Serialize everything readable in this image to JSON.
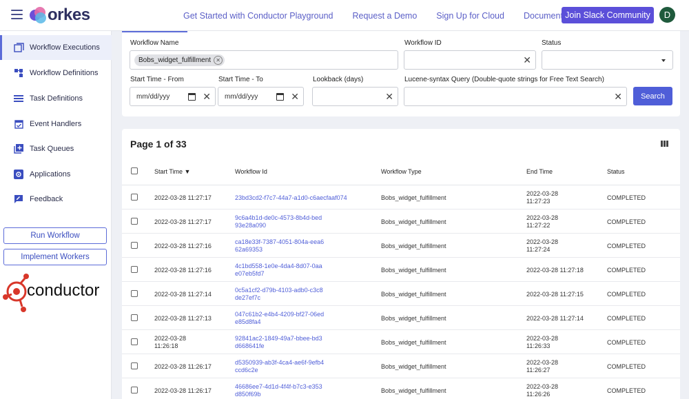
{
  "header": {
    "logo_text": "orkes",
    "nav": [
      "Get Started with Conductor Playground",
      "Request a Demo",
      "Sign Up for Cloud",
      "Documentation"
    ],
    "slack_button": "Join Slack Community",
    "avatar_initial": "D",
    "accent_color": "#5b4fd9"
  },
  "sidebar": {
    "items": [
      {
        "label": "Workflow Executions",
        "icon": "window-icon"
      },
      {
        "label": "Workflow Definitions",
        "icon": "nodes-icon"
      },
      {
        "label": "Task Definitions",
        "icon": "list-icon"
      },
      {
        "label": "Event Handlers",
        "icon": "calendar-check-icon"
      },
      {
        "label": "Task Queues",
        "icon": "queue-add-icon"
      },
      {
        "label": "Applications",
        "icon": "gear-box-icon"
      },
      {
        "label": "Feedback",
        "icon": "feedback-icon"
      }
    ],
    "run_workflow": "Run Workflow",
    "implement_workers": "Implement Workers",
    "brand_logo": "conductor"
  },
  "filters": {
    "workflow_name_label": "Workflow Name",
    "workflow_name_chip": "Bobs_widget_fulfillment",
    "workflow_id_label": "Workflow ID",
    "workflow_id_value": "",
    "status_label": "Status",
    "status_value": "",
    "start_from_label": "Start Time - From",
    "start_from_value": "mm/dd/yyy",
    "start_to_label": "Start Time - To",
    "start_to_value": "mm/dd/yyy",
    "lookback_label": "Lookback (days)",
    "lookback_value": "",
    "lucene_label": "Lucene-syntax Query (Double-quote strings for Free Text Search)",
    "lucene_value": "",
    "search_button": "Search"
  },
  "results": {
    "page_title": "Page 1 of 33",
    "columns": [
      "Start Time ▼",
      "Workflow Id",
      "Workflow Type",
      "End Time",
      "Status"
    ],
    "rows": [
      {
        "start": "2022-03-28 11:27:17",
        "id": "23bd3cd2-f7c7-44a7-a1d0-c6aecfaaf074",
        "type": "Bobs_widget_fulfillment",
        "end": "2022-03-28 11:27:23",
        "status": "COMPLETED"
      },
      {
        "start": "2022-03-28 11:27:17",
        "id": "9c6a4b1d-de0c-4573-8b4d-bed93e28a090",
        "type": "Bobs_widget_fulfillment",
        "end": "2022-03-28 11:27:22",
        "status": "COMPLETED"
      },
      {
        "start": "2022-03-28 11:27:16",
        "id": "ca18e33f-7387-4051-804a-eea662a69353",
        "type": "Bobs_widget_fulfillment",
        "end": "2022-03-28 11:27:24",
        "status": "COMPLETED"
      },
      {
        "start": "2022-03-28 11:27:16",
        "id": "4c1bd558-1e0e-4da4-8d07-0aae07eb5fd7",
        "type": "Bobs_widget_fulfillment",
        "end": "2022-03-28 11:27:18",
        "status": "COMPLETED"
      },
      {
        "start": "2022-03-28 11:27:14",
        "id": "0c5a1cf2-d79b-4103-adb0-c3c8de27ef7c",
        "type": "Bobs_widget_fulfillment",
        "end": "2022-03-28 11:27:15",
        "status": "COMPLETED"
      },
      {
        "start": "2022-03-28 11:27:13",
        "id": "047c61b2-e4b4-4209-bf27-06ede85d8fa4",
        "type": "Bobs_widget_fulfillment",
        "end": "2022-03-28 11:27:14",
        "status": "COMPLETED"
      },
      {
        "start": "2022-03-28 11:26:18",
        "id": "92841ac2-1849-49a7-bbee-bd3d668641fe",
        "type": "Bobs_widget_fulfillment",
        "end": "2022-03-28 11:26:33",
        "status": "COMPLETED"
      },
      {
        "start": "2022-03-28 11:26:17",
        "id": "d5350939-ab3f-4ca4-ae6f-9efb4ccd6c2e",
        "type": "Bobs_widget_fulfillment",
        "end": "2022-03-28 11:26:27",
        "status": "COMPLETED"
      },
      {
        "start": "2022-03-28 11:26:17",
        "id": "46686ee7-4d1d-4f4f-b7c3-e353d850f69b",
        "type": "Bobs_widget_fulfillment",
        "end": "2022-03-28 11:26:26",
        "status": "COMPLETED"
      }
    ]
  }
}
